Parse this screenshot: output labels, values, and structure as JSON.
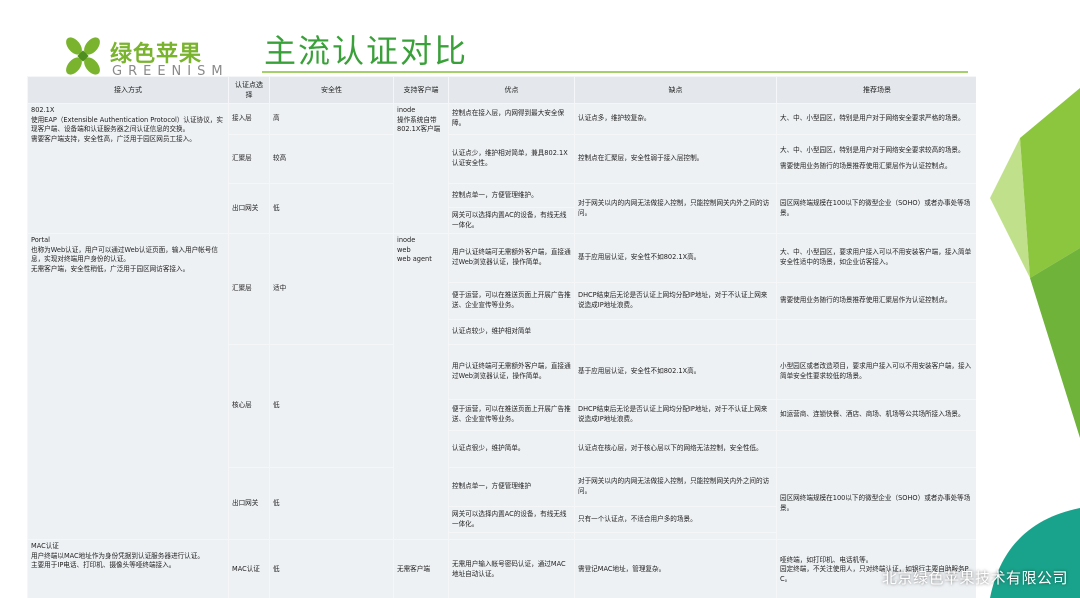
{
  "header": {
    "brand_cn": "绿色苹果",
    "brand_en": "GREENISM",
    "title": "主流认证对比"
  },
  "colors": {
    "brand_green": "#7ab32e",
    "title_green": "#3aa03a",
    "rule": "#a4d06a",
    "table_bg": "#eef1f4",
    "header_bg": "#e4e8ec"
  },
  "table": {
    "headers": [
      "接入方式",
      "认证点选择",
      "安全性",
      "支持客户端",
      "优点",
      "缺点",
      "推荐场景"
    ],
    "methods": {
      "dot1x": {
        "lines": [
          "802.1X",
          "使用EAP（Extensible Authentication Protocol）认证协议，实现客户端、设备端和认证服务器之间认证信息的交换。",
          "需要客户端支持，安全性高，广泛用于园区网员工接入。"
        ]
      },
      "portal": {
        "lines": [
          "Portal",
          "也称为Web认证，用户可以通过Web认证页面，输入用户帐号信息，实现对终端用户身份的认证。",
          "无需客户端，安全性稍低，广泛用于园区网访客接入。"
        ]
      },
      "mac": {
        "lines": [
          "MAC认证",
          "用户终端以MAC地址作为身份凭据到认证服务器进行认证。",
          "主要用于IP电话、打印机、摄像头等哑终端接入。"
        ]
      }
    },
    "clients": {
      "dot1x": [
        "inode",
        "操作系统自带",
        "802.1X客户端"
      ],
      "portal": [
        "inode",
        "web",
        "web agent"
      ],
      "mac": "无需客户端"
    },
    "points": {
      "d_access": "接入层",
      "d_agg": "汇聚层",
      "d_exit": "出口网关",
      "p_agg": "汇聚层",
      "p_core": "核心层",
      "p_exit": "出口网关",
      "m": "MAC认证"
    },
    "security": {
      "d_access": "高",
      "d_agg": "较高",
      "d_exit": "低",
      "p_agg": "适中",
      "p_core": "低",
      "p_exit": "低",
      "m": "低"
    },
    "pros": {
      "r1": "控制点在接入层，内网得到最大安全保障。",
      "r2": "认证点少，维护相对简单，兼具802.1X认证安全性。",
      "r3": "控制点单一，方便管理维护。",
      "r4": "网关可以选择内置AC的设备，有线无线一体化。",
      "r5": "用户认证终端可无需额外客户端，直接通过Web浏览器认证，操作简单。",
      "r6": "便于运营，可以在推送页面上开展广告推送、企业宣传等业务。",
      "r7": "认证点较少，维护相对简单",
      "r8": "用户认证终端可无需额外客户端，直接通过Web浏览器认证，操作简单。",
      "r9": "便于运营，可以在推送页面上开展广告推送、企业宣传等业务。",
      "r10": "认证点很少，维护简单。",
      "r11": "控制点单一，方便管理维护",
      "r12": "网关可以选择内置AC的设备，有线无线一体化。",
      "r13": "无需用户输入帐号密码认证，通过MAC地址自动认证。"
    },
    "cons": {
      "r1": "认证点多，维护较复杂。",
      "r2": "控制点在汇聚层，安全性弱于接入层控制。",
      "r3": "对于网关以内的内网无法做接入控制，只能控制网关内外之间的访问。",
      "r5": "基于应用层认证，安全性不如802.1X高。",
      "r6": "DHCP结束后无论是否认证上网均分配IP地址，对于不认证上网来说造成IP地址浪费。",
      "r8": "基于应用层认证，安全性不如802.1X高。",
      "r9": "DHCP结束后无论是否认证上网均分配IP地址，对于不认证上网来说造成IP地址浪费。",
      "r10": "认证点在核心层，对于核心层以下的网络无法控制，安全性低。",
      "r11": "对于网关以内的内网无法做接入控制，只能控制网关内外之间的访问。",
      "r12": "只有一个认证点，不适合用户多的场景。",
      "r13": "需登记MAC地址，管理复杂。"
    },
    "scenes": {
      "r1": "大、中、小型园区，特别是用户对于网络安全要求严格的场景。",
      "r2a": "大、中、小型园区，特别是用户对于网络安全要求较高的场景。",
      "r2b": "需要使用业务随行的场景推荐使用汇聚层作为认证控制点。",
      "r3": "园区网终端规模在100以下的微型企业（SOHO）或者办事处等场景。",
      "r5": "大、中、小型园区，要求用户接入可以不用安装客户端，接入简单安全性适中的场景，如企业访客接入。",
      "r6": "需要使用业务随行的场景推荐使用汇聚层作为认证控制点。",
      "r8": "小型园区或者改造项目，要求用户接入可以不用安装客户端，接入简单安全性要求较低的场景。",
      "r9": "如运营商、连锁快餐、酒店、商场、机场等公共场所接入场景。",
      "r11": "园区网终端规模在100以下的微型企业（SOHO）或者办事处等场景。",
      "r13a": "哑终端，如打印机、电话机等。",
      "r13b": "园定终端，不关注使用人，只对终端认证，如银行主要自助服务PC。"
    }
  },
  "watermark": "北京绿色苹果技术有限公司"
}
